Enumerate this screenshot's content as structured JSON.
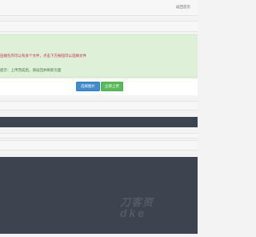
{
  "header": {
    "right_text": "返回首页"
  },
  "notice": {
    "line1": "压缩包内可以有多个文件，点击下方按钮可以选择文件",
    "line2": "提示：上传完成后，请返回并刷新页面"
  },
  "buttons": {
    "select_label": "选择图片",
    "upload_label": "立即上传"
  },
  "watermark": {
    "line1": "刀客资",
    "line2": "dke"
  },
  "colors": {
    "notice_bg": "#dff0d8",
    "select_btn": "#428bca",
    "upload_btn": "#5cb85c",
    "dark_panel": "#3d4450"
  }
}
